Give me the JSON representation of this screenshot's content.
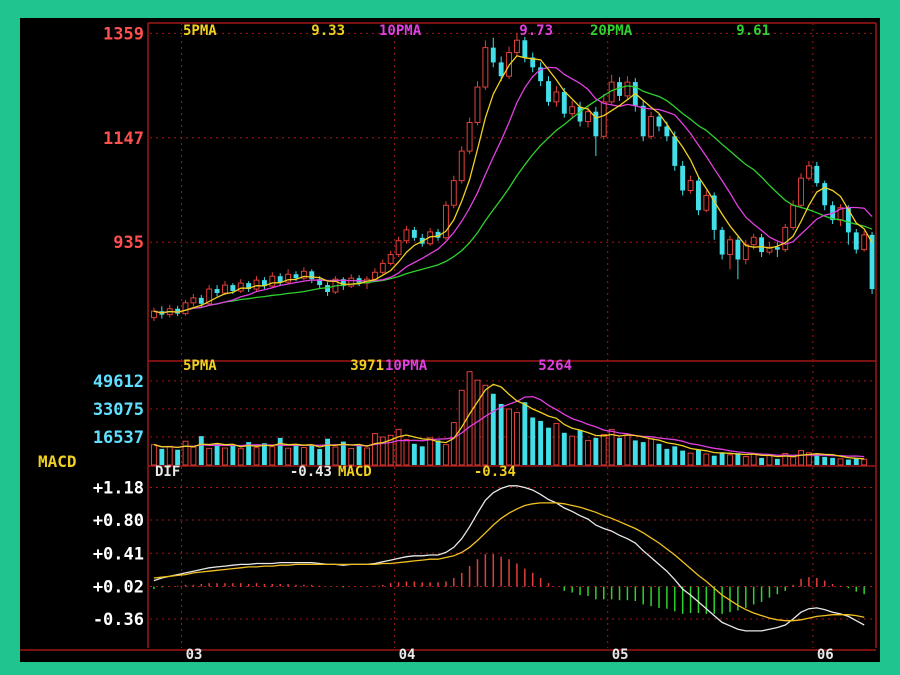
{
  "colors": {
    "background": "#000000",
    "frame": "#1fc48f",
    "up": "#e0403a",
    "down": "#42dfe8",
    "ma5": "#f0d020",
    "ma10": "#e040e0",
    "ma20": "#30d030",
    "dif": "#e8e8e8",
    "macd_line": "#f0c020",
    "grid": "#a01818",
    "price_tick": "#ff5050",
    "vol_tick": "#60e0ff",
    "macd_tick": "#ffffff",
    "macd_title": "#f0d020"
  },
  "price_panel": {
    "legend": [
      {
        "label": "5PMA",
        "value": "9.33",
        "color": "#f0d020"
      },
      {
        "label": "10PMA",
        "value": "9.73",
        "color": "#e040e0"
      },
      {
        "label": "20PMA",
        "value": "9.61",
        "color": "#30d030"
      }
    ],
    "y_ticks": [
      "1359",
      "1147",
      "935"
    ]
  },
  "volume_panel": {
    "legend": [
      {
        "label": "5PMA",
        "value": "3971",
        "color": "#f0d020"
      },
      {
        "label": "10PMA",
        "value": "5264",
        "color": "#e040e0"
      }
    ],
    "y_ticks": [
      "49612",
      "33075",
      "16537"
    ]
  },
  "macd_panel": {
    "title": "MACD",
    "legend": [
      {
        "label": "DIF",
        "value": "-0.43",
        "color": "#e8e8e8"
      },
      {
        "label": "MACD",
        "value": "-0.34",
        "color": "#f0d020"
      }
    ],
    "y_ticks": [
      "+1.18",
      "+0.80",
      "+0.41",
      "+0.02",
      "-0.36"
    ]
  },
  "x_axis": {
    "months": [
      "03",
      "04",
      "05",
      "06"
    ]
  },
  "chart_data": {
    "type": "candlestick",
    "price_ylim": [
      700,
      1380
    ],
    "price_gridlines": [
      1359,
      1147,
      935
    ],
    "volume_ylim": [
      0,
      56000
    ],
    "volume_gridlines": [
      49612,
      33075,
      16537
    ],
    "macd_ylim": [
      -0.7,
      1.28
    ],
    "macd_gridlines": [
      1.18,
      0.8,
      0.41,
      0.02,
      -0.36
    ],
    "month_starts": [
      {
        "label": "03",
        "index": 4
      },
      {
        "label": "04",
        "index": 31
      },
      {
        "label": "05",
        "index": 58
      },
      {
        "label": "06",
        "index": 84
      }
    ],
    "ma5_last": 9.33,
    "ma10_last": 9.73,
    "ma20_last": 9.61,
    "vol_ma5_last": 3971,
    "vol_ma10_last": 5264,
    "dif_last": -0.43,
    "macd_last": -0.34,
    "candles": [
      [
        782,
        795,
        802,
        775
      ],
      [
        795,
        788,
        805,
        780
      ],
      [
        788,
        800,
        808,
        782
      ],
      [
        800,
        790,
        806,
        785
      ],
      [
        790,
        812,
        818,
        786
      ],
      [
        812,
        822,
        830,
        805
      ],
      [
        822,
        810,
        828,
        804
      ],
      [
        810,
        840,
        848,
        806
      ],
      [
        840,
        832,
        848,
        825
      ],
      [
        832,
        848,
        856,
        828
      ],
      [
        848,
        836,
        852,
        830
      ],
      [
        836,
        852,
        860,
        832
      ],
      [
        852,
        840,
        856,
        834
      ],
      [
        840,
        858,
        866,
        836
      ],
      [
        858,
        846,
        864,
        840
      ],
      [
        846,
        866,
        874,
        842
      ],
      [
        866,
        854,
        872,
        848
      ],
      [
        854,
        870,
        880,
        850
      ],
      [
        870,
        862,
        876,
        856
      ],
      [
        862,
        876,
        884,
        858
      ],
      [
        876,
        860,
        880,
        852
      ],
      [
        860,
        848,
        866,
        840
      ],
      [
        848,
        834,
        854,
        826
      ],
      [
        834,
        860,
        866,
        830
      ],
      [
        860,
        846,
        864,
        838
      ],
      [
        846,
        862,
        870,
        842
      ],
      [
        862,
        852,
        868,
        846
      ],
      [
        852,
        860,
        866,
        840
      ],
      [
        860,
        874,
        882,
        855
      ],
      [
        874,
        892,
        900,
        870
      ],
      [
        892,
        910,
        918,
        888
      ],
      [
        910,
        938,
        946,
        905
      ],
      [
        938,
        960,
        968,
        932
      ],
      [
        960,
        944,
        966,
        938
      ],
      [
        944,
        932,
        952,
        926
      ],
      [
        932,
        956,
        964,
        928
      ],
      [
        956,
        944,
        962,
        938
      ],
      [
        944,
        1010,
        1018,
        940
      ],
      [
        1010,
        1060,
        1070,
        1004
      ],
      [
        1060,
        1120,
        1130,
        1054
      ],
      [
        1120,
        1178,
        1188,
        1114
      ],
      [
        1178,
        1250,
        1262,
        1172
      ],
      [
        1250,
        1330,
        1345,
        1244
      ],
      [
        1330,
        1300,
        1350,
        1290
      ],
      [
        1300,
        1272,
        1312,
        1262
      ],
      [
        1272,
        1320,
        1332,
        1266
      ],
      [
        1320,
        1345,
        1360,
        1314
      ],
      [
        1345,
        1310,
        1352,
        1300
      ],
      [
        1310,
        1290,
        1320,
        1280
      ],
      [
        1290,
        1262,
        1300,
        1252
      ],
      [
        1262,
        1220,
        1272,
        1212
      ],
      [
        1220,
        1240,
        1252,
        1210
      ],
      [
        1240,
        1196,
        1248,
        1188
      ],
      [
        1196,
        1210,
        1222,
        1186
      ],
      [
        1210,
        1180,
        1220,
        1170
      ],
      [
        1180,
        1200,
        1212,
        1168
      ],
      [
        1200,
        1150,
        1210,
        1110
      ],
      [
        1150,
        1220,
        1236,
        1144
      ],
      [
        1220,
        1260,
        1275,
        1214
      ],
      [
        1260,
        1232,
        1270,
        1222
      ],
      [
        1232,
        1260,
        1272,
        1226
      ],
      [
        1260,
        1212,
        1268,
        1200
      ],
      [
        1212,
        1150,
        1222,
        1140
      ],
      [
        1150,
        1190,
        1200,
        1144
      ],
      [
        1190,
        1170,
        1196,
        1160
      ],
      [
        1170,
        1150,
        1180,
        1140
      ],
      [
        1150,
        1090,
        1160,
        1080
      ],
      [
        1090,
        1040,
        1100,
        1030
      ],
      [
        1040,
        1060,
        1070,
        1034
      ],
      [
        1060,
        1000,
        1066,
        990
      ],
      [
        1000,
        1030,
        1040,
        996
      ],
      [
        1030,
        960,
        1036,
        940
      ],
      [
        960,
        910,
        966,
        900
      ],
      [
        910,
        940,
        948,
        880
      ],
      [
        940,
        900,
        946,
        860
      ],
      [
        900,
        930,
        940,
        890
      ],
      [
        930,
        945,
        952,
        920
      ],
      [
        945,
        915,
        952,
        905
      ],
      [
        915,
        925,
        935,
        910
      ],
      [
        925,
        920,
        935,
        905
      ],
      [
        920,
        965,
        972,
        915
      ],
      [
        965,
        1010,
        1020,
        960
      ],
      [
        1010,
        1065,
        1075,
        1004
      ],
      [
        1065,
        1090,
        1100,
        1060
      ],
      [
        1090,
        1055,
        1098,
        1048
      ],
      [
        1055,
        1010,
        1060,
        1000
      ],
      [
        1010,
        980,
        1018,
        972
      ],
      [
        980,
        1005,
        1012,
        968
      ],
      [
        1005,
        955,
        1010,
        930
      ],
      [
        955,
        920,
        962,
        912
      ],
      [
        920,
        950,
        958,
        916
      ],
      [
        950,
        840,
        956,
        830
      ]
    ],
    "volumes": [
      12000,
      9500,
      11000,
      9000,
      14000,
      10500,
      17000,
      9800,
      12500,
      10000,
      11800,
      9600,
      13500,
      10200,
      12800,
      10800,
      16000,
      9900,
      11500,
      10300,
      12000,
      9400,
      15500,
      10600,
      13800,
      9700,
      11200,
      10000,
      18500,
      16500,
      17500,
      21000,
      15000,
      12500,
      11000,
      16000,
      14500,
      12000,
      25000,
      44000,
      55000,
      50000,
      47000,
      42000,
      36000,
      33000,
      31000,
      37000,
      28000,
      26000,
      22000,
      24500,
      19000,
      17000,
      20500,
      14500,
      16000,
      18000,
      21000,
      16000,
      17500,
      14500,
      13500,
      15500,
      12500,
      9500,
      11000,
      8500,
      7000,
      9000,
      6500,
      5500,
      7500,
      6000,
      7000,
      5000,
      6500,
      4200,
      5500,
      3600,
      6800,
      4800,
      8500,
      7200,
      6000,
      4800,
      4200,
      3600,
      3200,
      4000,
      3400
    ],
    "dif": [
      0.09,
      0.12,
      0.14,
      0.16,
      0.18,
      0.2,
      0.22,
      0.24,
      0.25,
      0.26,
      0.27,
      0.28,
      0.28,
      0.29,
      0.29,
      0.29,
      0.3,
      0.3,
      0.3,
      0.3,
      0.3,
      0.29,
      0.28,
      0.28,
      0.27,
      0.28,
      0.28,
      0.28,
      0.29,
      0.31,
      0.33,
      0.35,
      0.37,
      0.38,
      0.38,
      0.39,
      0.39,
      0.42,
      0.48,
      0.58,
      0.72,
      0.88,
      1.03,
      1.12,
      1.17,
      1.2,
      1.2,
      1.18,
      1.15,
      1.1,
      1.04,
      1.0,
      0.94,
      0.9,
      0.85,
      0.81,
      0.74,
      0.7,
      0.67,
      0.62,
      0.58,
      0.53,
      0.44,
      0.36,
      0.28,
      0.2,
      0.1,
      -0.01,
      -0.08,
      -0.16,
      -0.24,
      -0.32,
      -0.4,
      -0.44,
      -0.48,
      -0.5,
      -0.5,
      -0.5,
      -0.48,
      -0.46,
      -0.43,
      -0.36,
      -0.28,
      -0.24,
      -0.23,
      -0.25,
      -0.28,
      -0.3,
      -0.33,
      -0.38,
      -0.43
    ],
    "macd_line": [
      0.12,
      0.13,
      0.14,
      0.15,
      0.16,
      0.18,
      0.19,
      0.2,
      0.21,
      0.22,
      0.23,
      0.24,
      0.25,
      0.25,
      0.26,
      0.26,
      0.27,
      0.27,
      0.28,
      0.28,
      0.28,
      0.28,
      0.28,
      0.28,
      0.28,
      0.28,
      0.28,
      0.28,
      0.28,
      0.29,
      0.29,
      0.3,
      0.31,
      0.32,
      0.33,
      0.34,
      0.34,
      0.36,
      0.38,
      0.42,
      0.48,
      0.56,
      0.65,
      0.74,
      0.82,
      0.88,
      0.93,
      0.97,
      0.99,
      1.0,
      1.0,
      1.0,
      0.99,
      0.97,
      0.95,
      0.92,
      0.89,
      0.85,
      0.82,
      0.78,
      0.74,
      0.7,
      0.65,
      0.59,
      0.53,
      0.46,
      0.39,
      0.31,
      0.23,
      0.15,
      0.08,
      0.0,
      -0.08,
      -0.14,
      -0.2,
      -0.25,
      -0.29,
      -0.32,
      -0.35,
      -0.37,
      -0.38,
      -0.38,
      -0.37,
      -0.35,
      -0.33,
      -0.32,
      -0.31,
      -0.31,
      -0.31,
      -0.32,
      -0.34
    ]
  }
}
